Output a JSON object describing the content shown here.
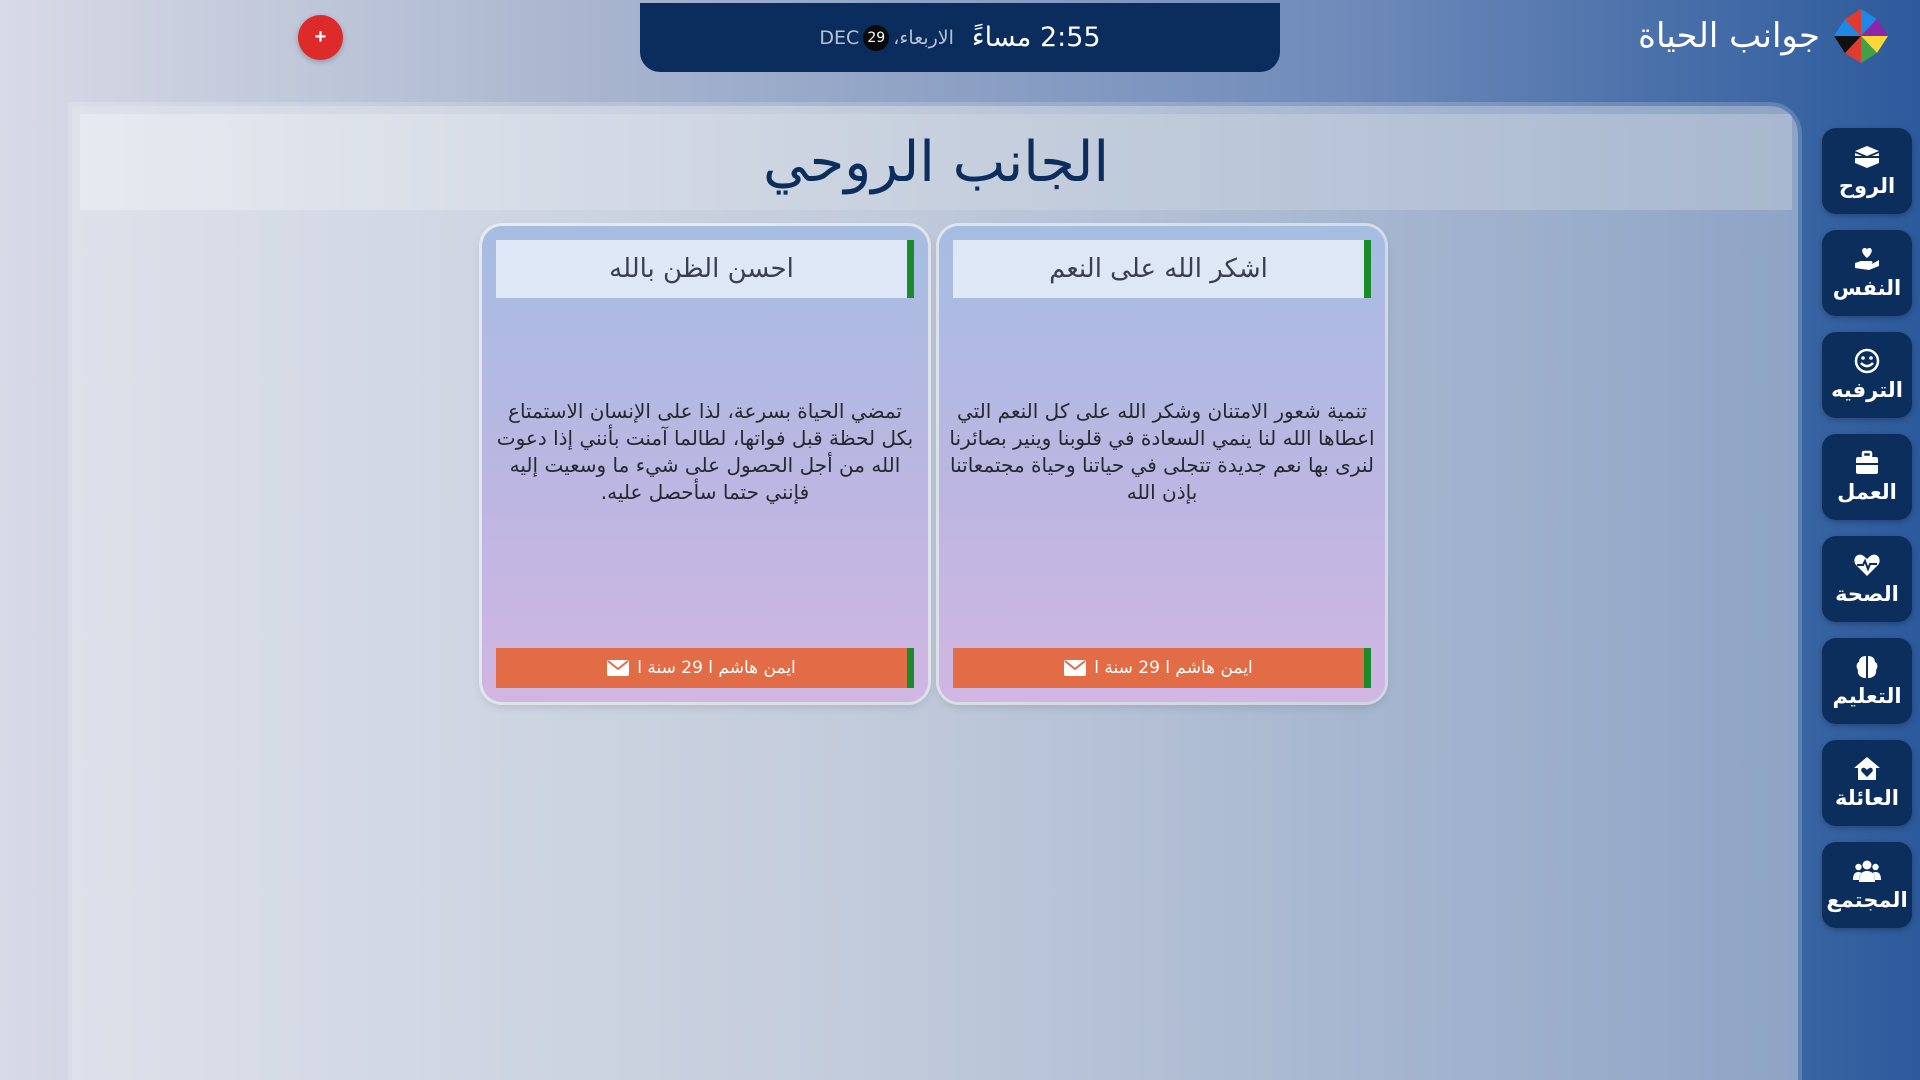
{
  "app": {
    "title": "جوانب الحياة",
    "logo_colors": [
      "#e23b2e",
      "#1e88e5",
      "#43a047",
      "#fdd835",
      "#8e24aa",
      "#111111"
    ]
  },
  "clock": {
    "time": "2:55 مساءً",
    "day": "الاربعاء،",
    "date_number": "29",
    "month": "DEC"
  },
  "add_button": {
    "label": "+"
  },
  "main": {
    "title": "الجانب الروحي"
  },
  "cards": [
    {
      "title": "اشكر الله على النعم",
      "body": "تنمية شعور الامتنان وشكر الله على كل النعم التي اعطاها الله لنا ينمي السعادة في قلوبنا وينير بصائرنا لنرى بها نعم جديدة تتجلى في حياتنا وحياة مجتمعاتنا بإذن الله",
      "author": "ايمن هاشم ا 29 سنة ا",
      "icon": "envelope-icon"
    },
    {
      "title": "احسن الظن بالله",
      "body": "تمضي الحياة بسرعة، لذا على الإنسان الاستمتاع بكل لحظة قبل فواتها، لطالما آمنت بأنني إذا دعوت الله من أجل الحصول على شيء ما وسعيت إليه فإنني حتما سأحصل عليه.",
      "author": "ايمن هاشم ا 29 سنة ا",
      "icon": "envelope-icon"
    }
  ],
  "sidebar": {
    "items": [
      {
        "label": "الروح",
        "icon": "kaaba-icon"
      },
      {
        "label": "النفس",
        "icon": "hand-heart-icon"
      },
      {
        "label": "الترفيه",
        "icon": "smile-icon"
      },
      {
        "label": "العمل",
        "icon": "briefcase-icon"
      },
      {
        "label": "الصحة",
        "icon": "heartbeat-icon"
      },
      {
        "label": "التعليم",
        "icon": "brain-icon"
      },
      {
        "label": "العائلة",
        "icon": "home-heart-icon"
      },
      {
        "label": "المجتمع",
        "icon": "users-icon"
      }
    ]
  },
  "colors": {
    "accent_navy": "#0b2e5d",
    "card_footer": "#e26c46",
    "card_stripe": "#1a8a2a",
    "add_button": "#dd2b2b"
  }
}
